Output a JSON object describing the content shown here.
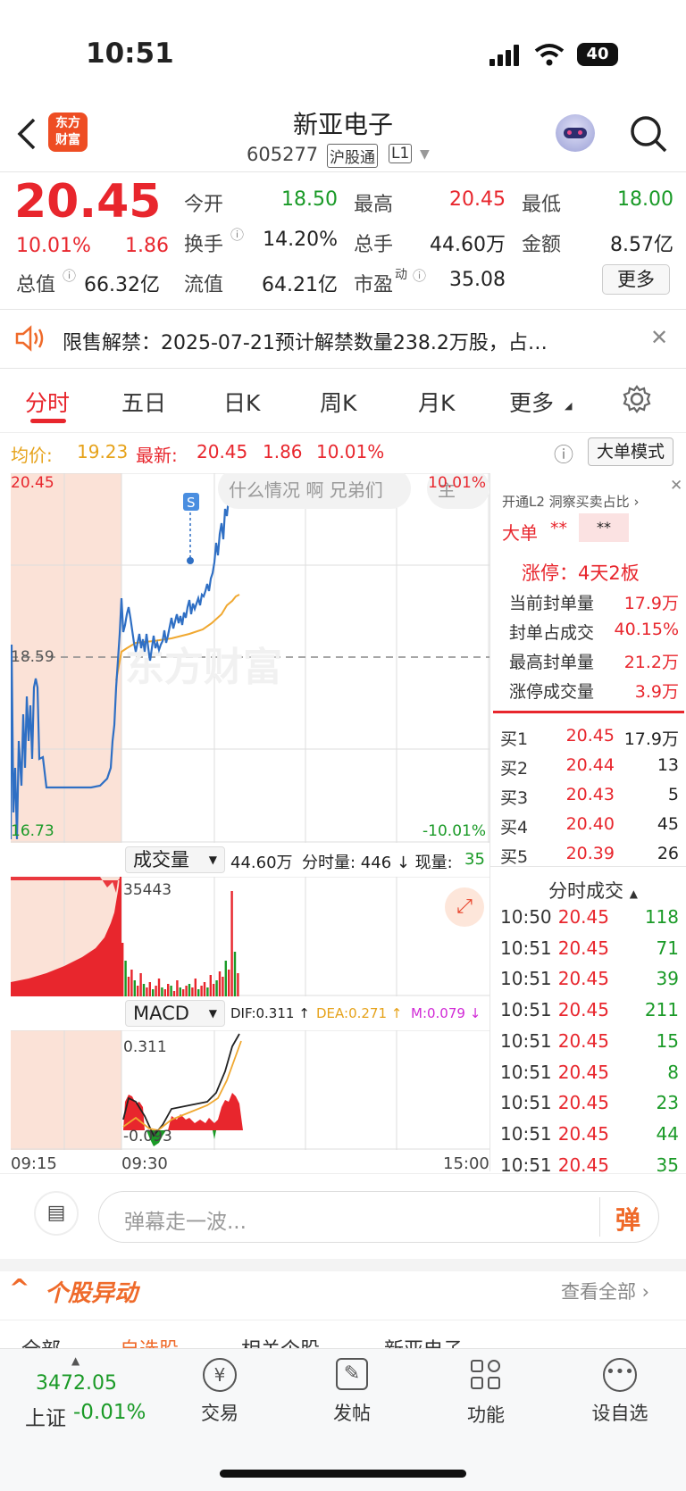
{
  "status_bar": {
    "time": "10:51",
    "battery": "40"
  },
  "header": {
    "logo_line1": "东方",
    "logo_line2": "财富",
    "title": "新亚电子",
    "code": "605277",
    "tag1": "沪股通",
    "tag2": "L1"
  },
  "quote": {
    "price": "20.45",
    "pct": "10.01%",
    "change": "1.86",
    "open_label": "今开",
    "open": "18.50",
    "high_label": "最高",
    "high": "20.45",
    "low_label": "最低",
    "low": "18.00",
    "turnover_label": "换手",
    "turnover": "14.20%",
    "volume_label": "总手",
    "volume": "44.60万",
    "amount_label": "金额",
    "amount": "8.57亿",
    "mktcap_label": "总值",
    "mktcap": "66.32亿",
    "float_label": "流值",
    "float": "64.21亿",
    "pe_label": "市盈",
    "pe_sup": "动",
    "pe": "35.08",
    "more": "更多"
  },
  "notice": {
    "text": "限售解禁：2025-07-21预计解禁数量238.2万股，占…"
  },
  "tabs": [
    "分时",
    "五日",
    "日K",
    "周K",
    "月K",
    "更多"
  ],
  "chart_header": {
    "avg_label": "均价:",
    "avg": "19.23",
    "latest_label": "最新:",
    "latest": "20.45",
    "change": "1.86",
    "pct": "10.01%",
    "mode_btn": "大单模式"
  },
  "chart_labels": {
    "top_price": "20.45",
    "mid_price": "18.59",
    "bottom_price": "16.73",
    "top_pct": "10.01%",
    "bottom_pct": "-10.01%",
    "bullet": "什么情况 啊 兄弟们",
    "bullet2": "主",
    "marker": "S",
    "watermark": "东方财富"
  },
  "volume_bar": {
    "select": "成交量",
    "total": "44.60万",
    "detail": "分时量: 446 ↓ 现量:",
    "now": "35",
    "max": "35443"
  },
  "macd_bar": {
    "select": "MACD",
    "dif": "DIF:0.311 ↑",
    "dea": "DEA:0.271 ↑",
    "m": "M:0.079 ↓",
    "top": "0.311",
    "bottom": "-0.093"
  },
  "time_axis": [
    "09:15",
    "09:30",
    "15:00"
  ],
  "side": {
    "promo": "开通L2 洞察买卖占比",
    "big_label": "大单",
    "big_stars": "**",
    "big_stars2": "**",
    "limit_title": "涨停：4天2板",
    "limit_rows": [
      {
        "label": "当前封单量",
        "value": "17.9万"
      },
      {
        "label": "封单占成交",
        "value": "40.15%"
      },
      {
        "label": "最高封单量",
        "value": "21.2万"
      },
      {
        "label": "涨停成交量",
        "value": "3.9万"
      }
    ],
    "bids": [
      {
        "label": "买1",
        "price": "20.45",
        "vol": "17.9万"
      },
      {
        "label": "买2",
        "price": "20.44",
        "vol": "13"
      },
      {
        "label": "买3",
        "price": "20.43",
        "vol": "5"
      },
      {
        "label": "买4",
        "price": "20.40",
        "vol": "45"
      },
      {
        "label": "买5",
        "price": "20.39",
        "vol": "26"
      }
    ],
    "trades_title": "分时成交",
    "trades": [
      {
        "time": "10:50",
        "price": "20.45",
        "vol": "118"
      },
      {
        "time": "10:51",
        "price": "20.45",
        "vol": "71"
      },
      {
        "time": "10:51",
        "price": "20.45",
        "vol": "39"
      },
      {
        "time": "10:51",
        "price": "20.45",
        "vol": "211"
      },
      {
        "time": "10:51",
        "price": "20.45",
        "vol": "15"
      },
      {
        "time": "10:51",
        "price": "20.45",
        "vol": "8"
      },
      {
        "time": "10:51",
        "price": "20.45",
        "vol": "23"
      },
      {
        "time": "10:51",
        "price": "20.45",
        "vol": "44"
      },
      {
        "time": "10:51",
        "price": "20.45",
        "vol": "35"
      }
    ]
  },
  "danmu": {
    "placeholder": "弹幕走一波...",
    "btn": "弹"
  },
  "section": {
    "title": "个股异动",
    "link": "查看全部",
    "subtabs": [
      "全部",
      "自选股",
      "相关个股",
      "新亚电子"
    ]
  },
  "bottom_nav": {
    "index_value": "3472.05",
    "index_name": "上证",
    "index_pct": "-0.01%",
    "items": [
      "交易",
      "发帖",
      "功能",
      "设自选"
    ]
  },
  "chart_data": {
    "type": "line",
    "title": "",
    "x_range": [
      "09:15",
      "15:00"
    ],
    "ylim": [
      16.73,
      20.45
    ],
    "prev_close": 18.59,
    "series": [
      {
        "name": "price",
        "values": [
          [
            0,
            17.0
          ],
          [
            3,
            17.0
          ],
          [
            4,
            17.9
          ],
          [
            6,
            18.1
          ],
          [
            8,
            17.9
          ],
          [
            10,
            17.85
          ],
          [
            12,
            17.5
          ],
          [
            14,
            17.45
          ],
          [
            16,
            17.45
          ],
          [
            18,
            17.46
          ],
          [
            19,
            18.0
          ],
          [
            20,
            18.4
          ],
          [
            21,
            18.8
          ],
          [
            22,
            18.9
          ],
          [
            23,
            18.75
          ],
          [
            24,
            18.7
          ],
          [
            25,
            18.9
          ],
          [
            26,
            18.75
          ],
          [
            27,
            18.7
          ],
          [
            28,
            18.8
          ],
          [
            29,
            18.95
          ],
          [
            30,
            19.0
          ],
          [
            31,
            19.1
          ],
          [
            32,
            19.3
          ],
          [
            33,
            19.5
          ],
          [
            34,
            19.9
          ],
          [
            35,
            20.2
          ],
          [
            36,
            20.45
          ]
        ]
      },
      {
        "name": "avg",
        "values": [
          [
            19,
            18.3
          ],
          [
            22,
            18.7
          ],
          [
            25,
            18.72
          ],
          [
            28,
            18.78
          ],
          [
            31,
            18.85
          ],
          [
            33,
            18.95
          ],
          [
            35,
            19.15
          ],
          [
            36,
            19.23
          ]
        ]
      }
    ]
  }
}
